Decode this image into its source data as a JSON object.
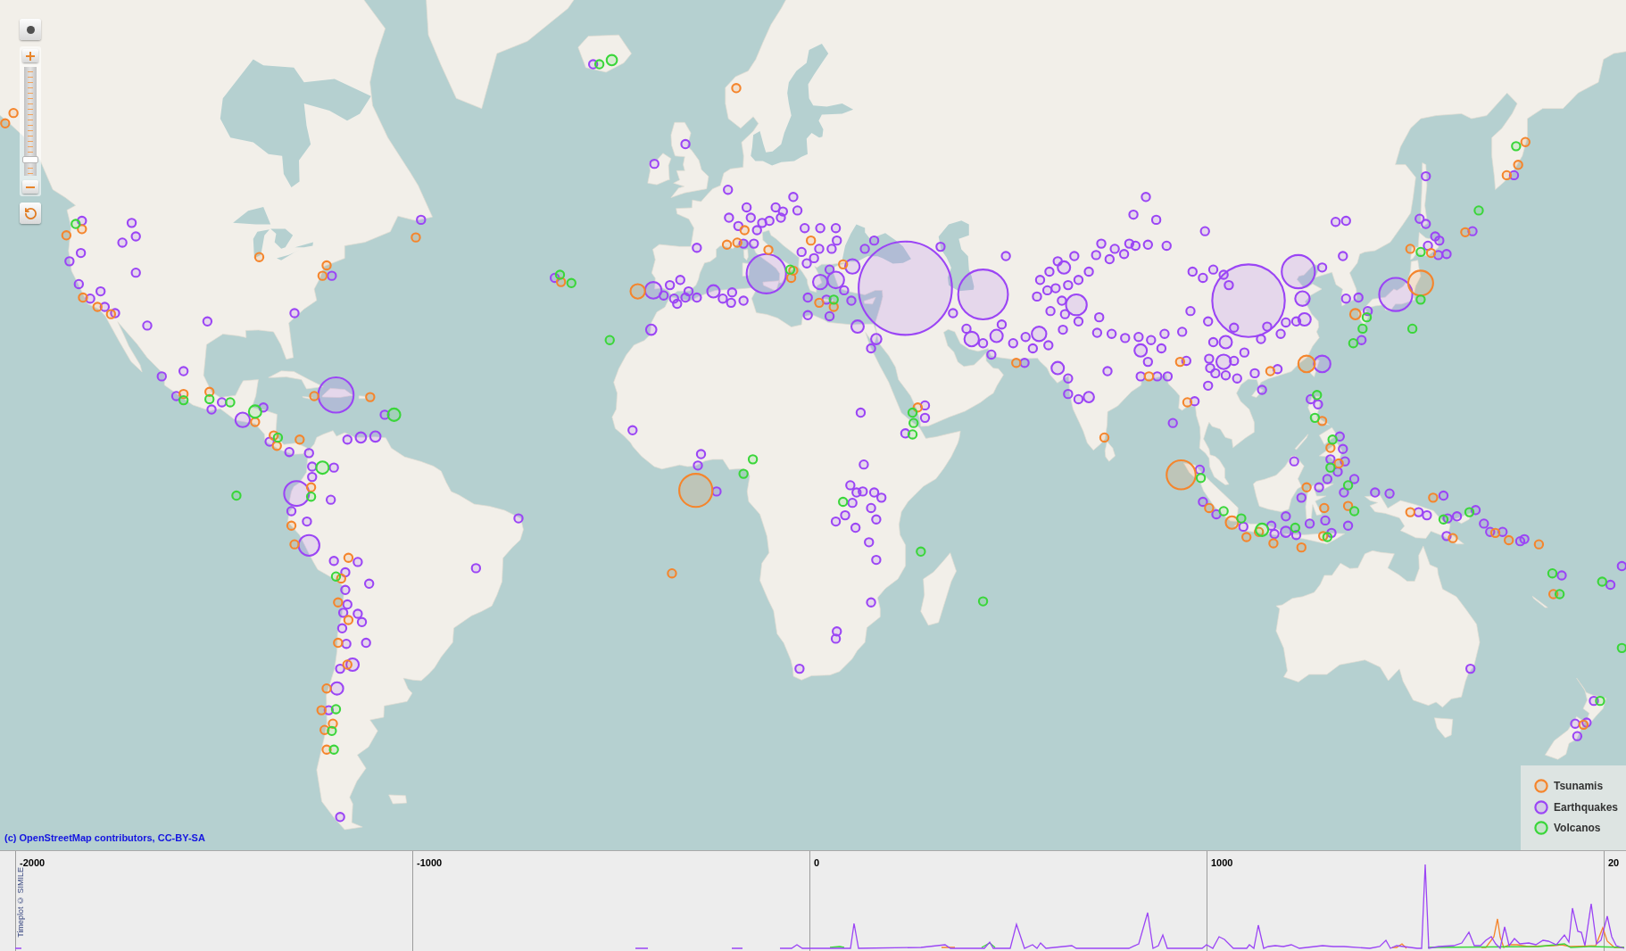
{
  "map": {
    "zoom_slider": {
      "level": 0.12
    },
    "attribution": "(c) OpenStreetMap contributors, CC-BY-SA"
  },
  "legend": {
    "items": [
      {
        "label": "Tsunamis",
        "color": "#f5852c"
      },
      {
        "label": "Earthquakes",
        "color": "#9b45f5"
      },
      {
        "label": "Volcanos",
        "color": "#3ad63a"
      }
    ]
  },
  "timeplot": {
    "credit": "Timeplot © SIMILE",
    "axis_labels": [
      "-2000",
      "-1000",
      "0",
      "1000",
      "20"
    ]
  }
}
